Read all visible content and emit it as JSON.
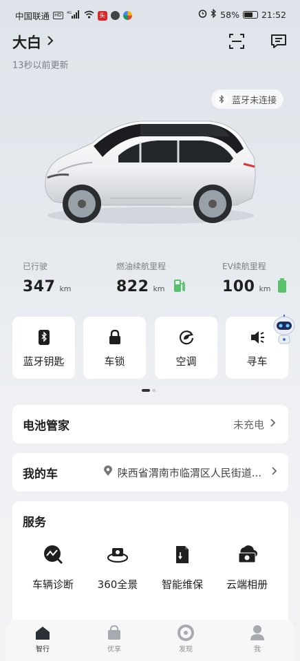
{
  "status_bar": {
    "carrier": "中国联通",
    "network_badges": [
      "HD",
      "4G"
    ],
    "battery_percent": "58%",
    "battery_level": 0.58,
    "time": "21:52",
    "icons": [
      "hd-icon",
      "signal-icon",
      "wifi-icon",
      "app-notification-icon",
      "alarm-icon",
      "bluetooth-icon",
      "battery-icon"
    ]
  },
  "header": {
    "car_name": "大白",
    "update_time": "13秒以前更新",
    "icons": [
      "chevron-right-icon",
      "scan-icon",
      "message-icon"
    ]
  },
  "bluetooth_status": {
    "label": "蓝牙未连接",
    "icon": "bluetooth-icon"
  },
  "stats": [
    {
      "label": "已行驶",
      "value": "347",
      "unit": "km"
    },
    {
      "label": "燃油续航里程",
      "value": "822",
      "unit": "km",
      "icon": "fuel-pump-icon",
      "color": "#5bc06b"
    },
    {
      "label": "EV续航里程",
      "value": "100",
      "unit": "km",
      "icon": "battery-icon",
      "color": "#5bc06b"
    }
  ],
  "controls": [
    {
      "label": "蓝牙钥匙",
      "icon": "bluetooth-key-icon"
    },
    {
      "label": "车锁",
      "icon": "lock-icon"
    },
    {
      "label": "空调",
      "icon": "air-conditioner-icon"
    },
    {
      "label": "寻车",
      "icon": "horn-icon"
    }
  ],
  "battery_manager": {
    "title": "电池管家",
    "status": "未充电"
  },
  "my_car": {
    "title": "我的车",
    "location": "陕西省渭南市临渭区人民街道..."
  },
  "services": {
    "title": "服务",
    "items": [
      {
        "label": "车辆诊断",
        "icon": "diagnosis-icon"
      },
      {
        "label": "360全景",
        "icon": "camera-360-icon"
      },
      {
        "label": "智能维保",
        "icon": "maintenance-icon"
      },
      {
        "label": "云端相册",
        "icon": "cloud-album-icon"
      }
    ]
  },
  "tabbar": {
    "items": [
      {
        "label": "智行",
        "icon": "home-icon",
        "active": true
      },
      {
        "label": "优享",
        "icon": "shopping-bag-icon",
        "active": false
      },
      {
        "label": "发现",
        "icon": "discover-icon",
        "active": false
      },
      {
        "label": "我",
        "icon": "profile-icon",
        "active": false
      }
    ]
  },
  "colors": {
    "accent_green": "#5bc06b",
    "text_primary": "#1f1f1f",
    "text_secondary": "#7c7f85"
  }
}
